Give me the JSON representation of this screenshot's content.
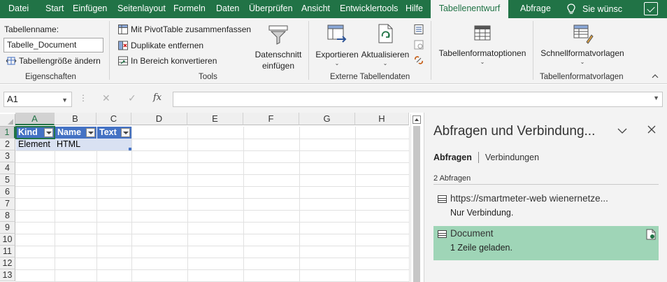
{
  "tabs": [
    {
      "label": "Datei",
      "active": false
    },
    {
      "label": "Start",
      "active": false
    },
    {
      "label": "Einfügen",
      "active": false
    },
    {
      "label": "Seitenlayout",
      "active": false
    },
    {
      "label": "Formeln",
      "active": false
    },
    {
      "label": "Daten",
      "active": false
    },
    {
      "label": "Überprüfen",
      "active": false
    },
    {
      "label": "Ansicht",
      "active": false
    },
    {
      "label": "Entwicklertools",
      "active": false
    },
    {
      "label": "Hilfe",
      "active": false
    },
    {
      "label": "Tabellenentwurf",
      "active": true
    },
    {
      "label": "Abfrage",
      "active": false
    }
  ],
  "search": {
    "label": "Sie wünsc",
    "icon": "lightbulb-icon"
  },
  "ribbon": {
    "eigenschaften": {
      "title": "Eigenschaften",
      "tablename_label": "Tabellenname:",
      "tablename_value": "Tabelle_Document",
      "resize_label": "Tabellengröße ändern"
    },
    "tools": {
      "title": "Tools",
      "pivot_label": "Mit PivotTable zusammenfassen",
      "dup_label": "Duplikate entfernen",
      "convert_label": "In Bereich konvertieren",
      "slicer_label_1": "Datenschnitt",
      "slicer_label_2": "einfügen"
    },
    "extern": {
      "title": "Externe Tabellendaten",
      "export_label": "Exportieren",
      "refresh_label": "Aktualisieren"
    },
    "format_options": {
      "label": "Tabellenformatoptionen"
    },
    "styles": {
      "title": "Tabellenformatvorlagen",
      "quick_label": "Schnellformatvorlagen"
    },
    "caret": "⌄"
  },
  "formula_bar": {
    "namebox": "A1",
    "fx": "fx",
    "cancel": "✕",
    "enter": "✓",
    "dots": "⋮",
    "value": ""
  },
  "sheet": {
    "columns": [
      "A",
      "B",
      "C",
      "D",
      "E",
      "F",
      "G",
      "H"
    ],
    "rows": [
      "1",
      "2",
      "3",
      "4",
      "5",
      "6",
      "7",
      "8",
      "9",
      "10",
      "11",
      "12",
      "13"
    ],
    "table": {
      "headers": [
        "Kind",
        "Name",
        "Text"
      ],
      "row": [
        "Element",
        "HTML",
        ""
      ]
    }
  },
  "pane": {
    "title": "Abfragen und Verbindung...",
    "tab_queries": "Abfragen",
    "tab_connections": "Verbindungen",
    "count": "2 Abfragen",
    "queries": [
      {
        "name": "https://smartmeter-web wienernetze...",
        "status": "Nur Verbindung.",
        "selected": false
      },
      {
        "name": "Document",
        "status": "1 Zeile geladen.",
        "selected": true
      }
    ]
  },
  "colors": {
    "accent": "#217346",
    "table_header": "#4472c4",
    "table_band": "#d9e1f2",
    "selected_query": "#9fd5b7"
  }
}
